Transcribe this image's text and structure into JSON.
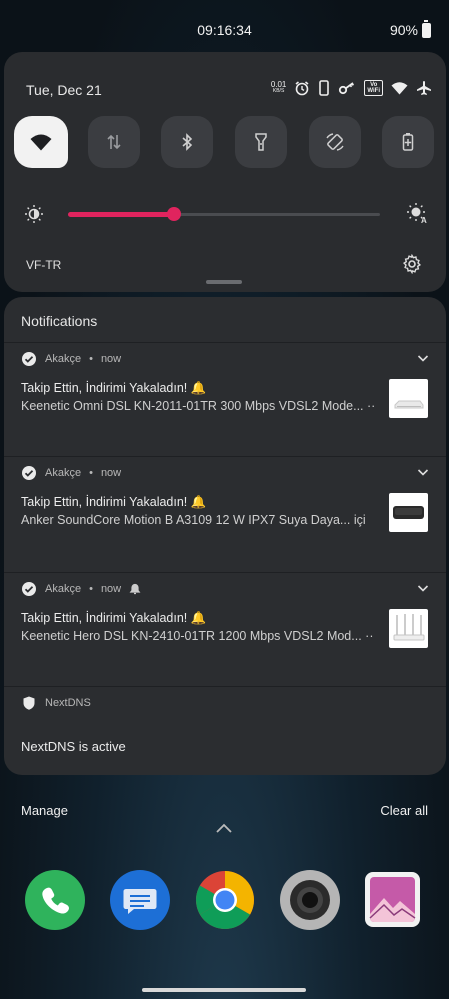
{
  "status_bar": {
    "time": "09:16:34",
    "battery": "90%"
  },
  "quick_settings": {
    "date": "Tue, Dec 21",
    "net_speed_top": "0.01",
    "net_speed_unit": "KB/S",
    "volte_top": "Vo",
    "volte_bottom": "WiFi",
    "carrier": "VF-TR",
    "brightness_level": 0.34,
    "tiles": [
      "wifi",
      "mobile-data",
      "bluetooth",
      "flashlight",
      "auto-rotate",
      "battery-saver"
    ]
  },
  "notifications": {
    "header": "Notifications",
    "items": [
      {
        "app": "Akakçe",
        "time": "now",
        "title": "Takip Ettin, İndirimi Yakaladın! 🔔",
        "text": "Keenetic Omni DSL KN-2011-01TR 300 Mbps VDSL2 Mode...",
        "dots": "··"
      },
      {
        "app": "Akakçe",
        "time": "now",
        "title": "Takip Ettin, İndirimi Yakaladın! 🔔",
        "text": "Anker SoundCore Motion B A3109 12 W IPX7 Suya Daya...",
        "dots": "içi"
      },
      {
        "app": "Akakçe",
        "time": "now",
        "title": "Takip Ettin, İndirimi Yakaladın! 🔔",
        "text": "Keenetic Hero DSL KN-2410-01TR 1200 Mbps VDSL2 Mod...",
        "dots": "··"
      }
    ],
    "nextdns": {
      "app": "NextDNS",
      "text": "NextDNS is active"
    }
  },
  "actions": {
    "manage": "Manage",
    "clear_all": "Clear all"
  },
  "colors": {
    "accent": "#e0245e",
    "panel": "#2b2d30"
  }
}
